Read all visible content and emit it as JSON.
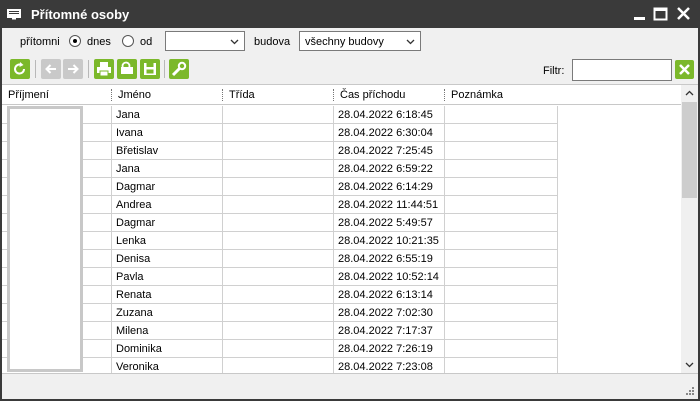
{
  "window": {
    "title": "Přítomné osoby",
    "icon": "id-card-icon"
  },
  "filters": {
    "present_label": "přítomni",
    "today_label": "dnes",
    "from_label": "od",
    "from_value": "",
    "building_label": "budova",
    "building_value": "všechny budovy",
    "selected_radio": "dnes"
  },
  "toolbar": {
    "buttons": [
      "refresh-icon",
      "back-icon",
      "forward-icon",
      "print-icon",
      "print-preview-icon",
      "save-icon",
      "settings-wrench-icon"
    ],
    "filter_label": "Filtr:",
    "filter_value": ""
  },
  "table": {
    "columns": [
      "Příjmení",
      "Jméno",
      "Třída",
      "Čas příchodu",
      "Poznámka"
    ],
    "rows": [
      {
        "prijmeni": "",
        "jmeno": "Jana",
        "trida": "",
        "cas": "28.04.2022 6:18:45",
        "poznamka": ""
      },
      {
        "prijmeni": "",
        "jmeno": "Ivana",
        "trida": "",
        "cas": "28.04.2022 6:30:04",
        "poznamka": ""
      },
      {
        "prijmeni": "",
        "jmeno": "Břetislav",
        "trida": "",
        "cas": "28.04.2022 7:25:45",
        "poznamka": ""
      },
      {
        "prijmeni": "",
        "jmeno": "Jana",
        "trida": "",
        "cas": "28.04.2022 6:59:22",
        "poznamka": ""
      },
      {
        "prijmeni": "",
        "jmeno": "Dagmar",
        "trida": "",
        "cas": "28.04.2022 6:14:29",
        "poznamka": ""
      },
      {
        "prijmeni": "",
        "jmeno": "Andrea",
        "trida": "",
        "cas": "28.04.2022 11:44:51",
        "poznamka": ""
      },
      {
        "prijmeni": "",
        "jmeno": "Dagmar",
        "trida": "",
        "cas": "28.04.2022 5:49:57",
        "poznamka": ""
      },
      {
        "prijmeni": "",
        "jmeno": "Lenka",
        "trida": "",
        "cas": "28.04.2022 10:21:35",
        "poznamka": ""
      },
      {
        "prijmeni": "",
        "jmeno": "Denisa",
        "trida": "",
        "cas": "28.04.2022 6:55:19",
        "poznamka": ""
      },
      {
        "prijmeni": "",
        "jmeno": "Pavla",
        "trida": "",
        "cas": "28.04.2022 10:52:14",
        "poznamka": ""
      },
      {
        "prijmeni": "",
        "jmeno": "Renata",
        "trida": "",
        "cas": "28.04.2022 6:13:14",
        "poznamka": ""
      },
      {
        "prijmeni": "",
        "jmeno": "Zuzana",
        "trida": "",
        "cas": "28.04.2022 7:02:30",
        "poznamka": ""
      },
      {
        "prijmeni": "",
        "jmeno": "Milena",
        "trida": "",
        "cas": "28.04.2022 7:17:37",
        "poznamka": ""
      },
      {
        "prijmeni": "",
        "jmeno": "Dominika",
        "trida": "",
        "cas": "28.04.2022 7:26:19",
        "poznamka": ""
      },
      {
        "prijmeni": "",
        "jmeno": "Veronika",
        "trida": "",
        "cas": "28.04.2022 7:23:08",
        "poznamka": ""
      }
    ]
  },
  "colors": {
    "titlebar": "#3a3a3a",
    "toolbar_icon_green": "#7bb82a",
    "window_bg": "#f0f0f0"
  }
}
